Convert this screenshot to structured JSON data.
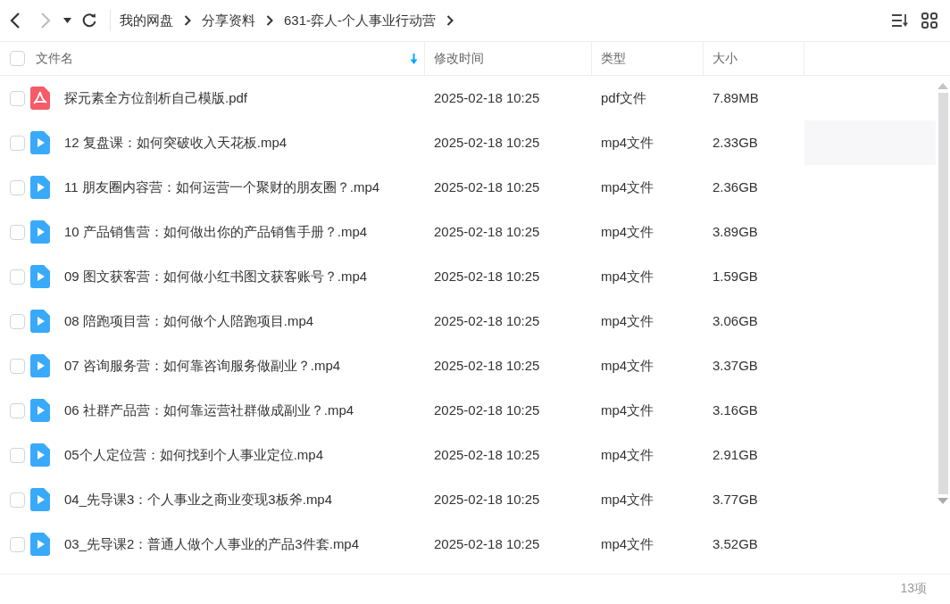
{
  "toolbar": {
    "breadcrumbs": [
      "我的网盘",
      "分享资料",
      "631-弈人-个人事业行动营"
    ]
  },
  "table": {
    "header_checked": false,
    "columns": [
      {
        "label": "文件名",
        "sorted": true
      },
      {
        "label": "修改时间",
        "sorted": false
      },
      {
        "label": "类型",
        "sorted": false
      },
      {
        "label": "大小",
        "sorted": false
      }
    ],
    "rows": [
      {
        "kind": "pdf",
        "name": "探元素全方位剖析自己模版.pdf",
        "modified": "2025-02-18 10:25",
        "type": "pdf文件",
        "size": "7.89MB",
        "checked": false,
        "hovered": false
      },
      {
        "kind": "video",
        "name": "12 复盘课：如何突破收入天花板.mp4",
        "modified": "2025-02-18 10:25",
        "type": "mp4文件",
        "size": "2.33GB",
        "checked": false,
        "hovered": true
      },
      {
        "kind": "video",
        "name": "11 朋友圈内容营：如何运营一个聚财的朋友圈？.mp4",
        "modified": "2025-02-18 10:25",
        "type": "mp4文件",
        "size": "2.36GB",
        "checked": false,
        "hovered": false
      },
      {
        "kind": "video",
        "name": "10 产品销售营：如何做出你的产品销售手册？.mp4",
        "modified": "2025-02-18 10:25",
        "type": "mp4文件",
        "size": "3.89GB",
        "checked": false,
        "hovered": false
      },
      {
        "kind": "video",
        "name": "09 图文获客营：如何做小红书图文获客账号？.mp4",
        "modified": "2025-02-18 10:25",
        "type": "mp4文件",
        "size": "1.59GB",
        "checked": false,
        "hovered": false
      },
      {
        "kind": "video",
        "name": "08 陪跑项目营：如何做个人陪跑项目.mp4",
        "modified": "2025-02-18 10:25",
        "type": "mp4文件",
        "size": "3.06GB",
        "checked": false,
        "hovered": false
      },
      {
        "kind": "video",
        "name": "07 咨询服务营：如何靠咨询服务做副业？.mp4",
        "modified": "2025-02-18 10:25",
        "type": "mp4文件",
        "size": "3.37GB",
        "checked": false,
        "hovered": false
      },
      {
        "kind": "video",
        "name": "06 社群产品营：如何靠运营社群做成副业？.mp4",
        "modified": "2025-02-18 10:25",
        "type": "mp4文件",
        "size": "3.16GB",
        "checked": false,
        "hovered": false
      },
      {
        "kind": "video",
        "name": "05个人定位营：如何找到个人事业定位.mp4",
        "modified": "2025-02-18 10:25",
        "type": "mp4文件",
        "size": "2.91GB",
        "checked": false,
        "hovered": false
      },
      {
        "kind": "video",
        "name": "04_先导课3：个人事业之商业变现3板斧.mp4",
        "modified": "2025-02-18 10:25",
        "type": "mp4文件",
        "size": "3.77GB",
        "checked": false,
        "hovered": false
      },
      {
        "kind": "video",
        "name": "03_先导课2：普通人做个人事业的产品3件套.mp4",
        "modified": "2025-02-18 10:25",
        "type": "mp4文件",
        "size": "3.52GB",
        "checked": false,
        "hovered": false
      }
    ]
  },
  "status_bar": {
    "count": "13项"
  }
}
